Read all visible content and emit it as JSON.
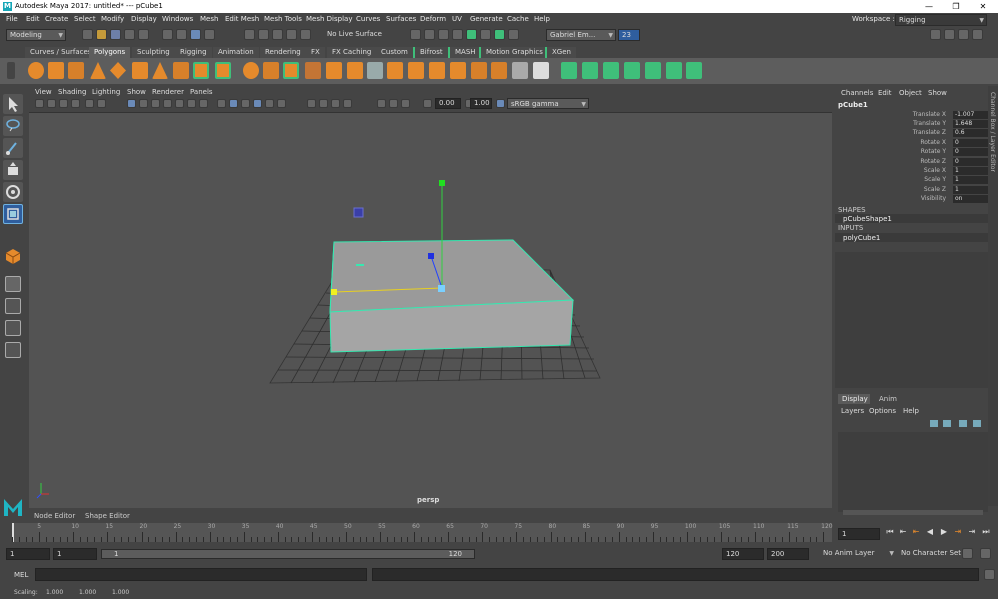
{
  "window": {
    "title": "Autodesk Maya 2017: untitled*   ---   pCube1",
    "controls": [
      "—",
      "❐",
      "✕"
    ]
  },
  "menubar": {
    "items": [
      "File",
      "Edit",
      "Create",
      "Select",
      "Modify",
      "Display",
      "Windows",
      "Mesh",
      "Edit Mesh",
      "Mesh Tools",
      "Mesh Display",
      "Curves",
      "Surfaces",
      "Deform",
      "UV",
      "Generate",
      "Cache",
      "Help"
    ],
    "workspace_label": "Workspace :",
    "workspace_value": "Rigging"
  },
  "statusline": {
    "menuset": "Modeling",
    "live_surface": "No Live Surface",
    "user": "Gabriel Em...",
    "notifications": "23"
  },
  "shelf": {
    "tabs": [
      "Curves / Surfaces",
      "Polygons",
      "Sculpting",
      "Rigging",
      "Animation",
      "Rendering",
      "FX",
      "FX Caching",
      "Custom",
      "Bifrost",
      "MASH",
      "Motion Graphics",
      "XGen"
    ],
    "active_tab": "Polygons",
    "colors": {
      "poly": "#e58a2c",
      "green": "#3fbf7a",
      "bg": "#5d5d5d"
    }
  },
  "viewport": {
    "menus": [
      "View",
      "Shading",
      "Lighting",
      "Show",
      "Renderer",
      "Panels"
    ],
    "gamma_in": "0.00",
    "gamma_out": "1.00",
    "color_space": "sRGB gamma",
    "camera_label": "persp"
  },
  "bottom_tabs": [
    "Node Editor",
    "Shape Editor"
  ],
  "channelbox": {
    "menus": [
      "Channels",
      "Edit",
      "Object",
      "Show"
    ],
    "object": "pCube1",
    "attributes": [
      {
        "name": "Translate X",
        "value": "-1.007"
      },
      {
        "name": "Translate Y",
        "value": "1.648"
      },
      {
        "name": "Translate Z",
        "value": "0.6"
      },
      {
        "name": "Rotate X",
        "value": "0"
      },
      {
        "name": "Rotate Y",
        "value": "0"
      },
      {
        "name": "Rotate Z",
        "value": "0"
      },
      {
        "name": "Scale X",
        "value": "1"
      },
      {
        "name": "Scale Y",
        "value": "1"
      },
      {
        "name": "Scale Z",
        "value": "1"
      },
      {
        "name": "Visibility",
        "value": "on"
      }
    ],
    "shapes_header": "SHAPES",
    "shape_node": "pCubeShape1",
    "inputs_header": "INPUTS",
    "input_node": "polyCube1",
    "side_label": "Channel Box / Layer Editor"
  },
  "layer_editor": {
    "tabs": [
      "Display",
      "Anim"
    ],
    "menus": [
      "Layers",
      "Options",
      "Help"
    ]
  },
  "timeline": {
    "ticks": [
      "5",
      "10",
      "15",
      "20",
      "25",
      "30",
      "35",
      "40",
      "45",
      "50",
      "55",
      "60",
      "65",
      "70",
      "75",
      "80",
      "85",
      "90",
      "95",
      "100",
      "105",
      "110",
      "115",
      "120"
    ],
    "current_frame": "1"
  },
  "range": {
    "start": "1",
    "playback_start": "1",
    "slider_start": "1",
    "slider_end": "120",
    "playback_end": "120",
    "end": "200",
    "anim_layer": "No Anim Layer",
    "char_set": "No Character Set"
  },
  "mel": {
    "label": "MEL"
  },
  "helpline": {
    "label": "Scaling:",
    "values": [
      "1.000",
      "1.000",
      "1.000"
    ]
  }
}
